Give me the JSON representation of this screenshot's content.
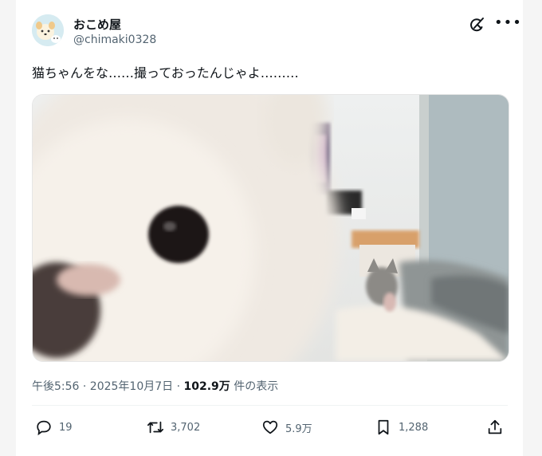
{
  "author": {
    "display_name": "おこめ屋",
    "handle": "@chimaki0328",
    "avatar_icon": "dog-avatar-icon"
  },
  "tweet": {
    "text": "猫ちゃんをな……撮っておったんじゃよ………"
  },
  "meta": {
    "time_date": "午後5:56 · 2025年10月7日",
    "separator": " · ",
    "views_count": "102.9万",
    "views_label": " 件の表示"
  },
  "actions": {
    "reply_count": "19",
    "retweet_count": "3,702",
    "like_count": "5.9万",
    "bookmark_count": "1,288"
  },
  "icons": {
    "grok": "grok-icon",
    "more": "more-icon",
    "reply": "reply-icon",
    "retweet": "retweet-icon",
    "like": "heart-icon",
    "bookmark": "bookmark-icon",
    "share": "share-icon"
  },
  "colors": {
    "secondary_text": "#536471",
    "primary_text": "#0f1419"
  }
}
